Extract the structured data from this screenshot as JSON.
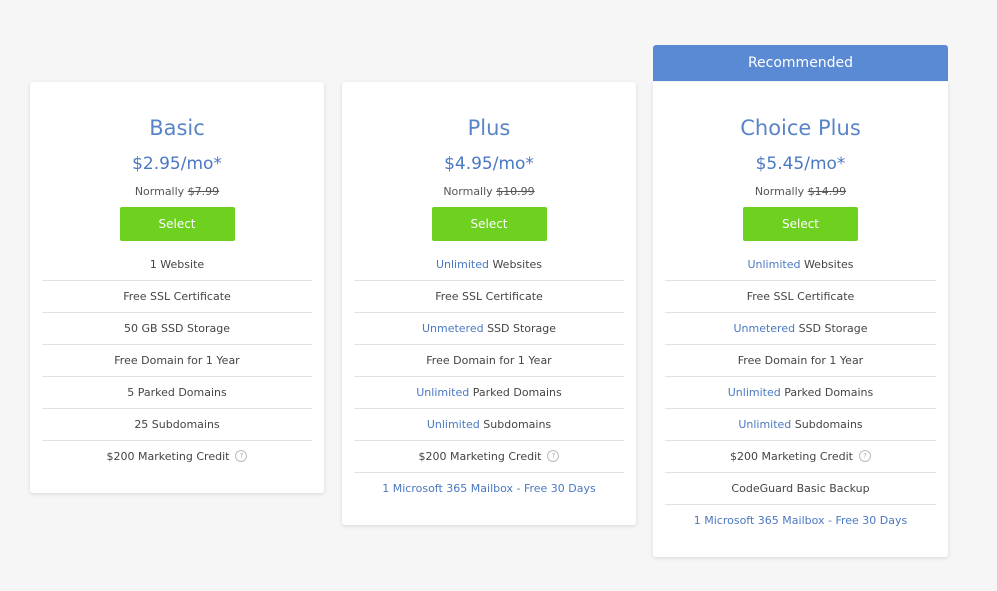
{
  "recommended_label": "Recommended",
  "plans": [
    {
      "name": "Basic",
      "price": "$2.95/mo*",
      "normally_label": "Normally",
      "normally_price": "$7.99",
      "select_label": "Select",
      "features": [
        {
          "hl": "",
          "text": "1 Website"
        },
        {
          "hl": "",
          "text": "Free SSL Certificate"
        },
        {
          "hl": "",
          "text": "50 GB SSD Storage"
        },
        {
          "hl": "",
          "text": "Free Domain for 1 Year"
        },
        {
          "hl": "",
          "text": "5 Parked Domains"
        },
        {
          "hl": "",
          "text": "25 Subdomains"
        },
        {
          "hl": "",
          "text": "$200 Marketing Credit"
        }
      ]
    },
    {
      "name": "Plus",
      "price": "$4.95/mo*",
      "normally_label": "Normally",
      "normally_price": "$10.99",
      "select_label": "Select",
      "features": [
        {
          "hl": "Unlimited",
          "text": " Websites"
        },
        {
          "hl": "",
          "text": "Free SSL Certificate"
        },
        {
          "hl": "Unmetered",
          "text": " SSD Storage"
        },
        {
          "hl": "",
          "text": "Free Domain for 1 Year"
        },
        {
          "hl": "Unlimited",
          "text": " Parked Domains"
        },
        {
          "hl": "Unlimited",
          "text": " Subdomains"
        },
        {
          "hl": "",
          "text": "$200 Marketing Credit"
        },
        {
          "hl": "",
          "text": "1 Microsoft 365 Mailbox - Free 30 Days"
        }
      ]
    },
    {
      "name": "Choice Plus",
      "price": "$5.45/mo*",
      "normally_label": "Normally",
      "normally_price": "$14.99",
      "select_label": "Select",
      "features": [
        {
          "hl": "Unlimited",
          "text": " Websites"
        },
        {
          "hl": "",
          "text": "Free SSL Certificate"
        },
        {
          "hl": "Unmetered",
          "text": " SSD Storage"
        },
        {
          "hl": "",
          "text": "Free Domain for 1 Year"
        },
        {
          "hl": "Unlimited",
          "text": " Parked Domains"
        },
        {
          "hl": "Unlimited",
          "text": " Subdomains"
        },
        {
          "hl": "",
          "text": "$200 Marketing Credit"
        },
        {
          "hl": "",
          "text": "CodeGuard Basic Backup"
        },
        {
          "hl": "",
          "text": "1 Microsoft 365 Mailbox - Free 30 Days"
        }
      ]
    }
  ],
  "help_icon_glyph": "?",
  "colors": {
    "accent_blue": "#4a78c2",
    "banner_blue": "#5a8ad4",
    "select_green": "#6ed120"
  }
}
